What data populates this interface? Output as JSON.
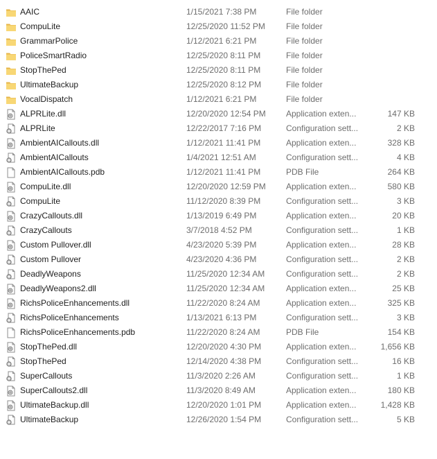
{
  "colors": {
    "folder": "#f8d775",
    "folder_dark": "#e6b54a",
    "secondary_text": "#6d6d6d",
    "primary_text": "#1e1e1e"
  },
  "files": [
    {
      "name": "AAIC",
      "date": "1/15/2021 7:38 PM",
      "type": "File folder",
      "size": "",
      "icon": "folder-icon"
    },
    {
      "name": "CompuLite",
      "date": "12/25/2020 11:52 PM",
      "type": "File folder",
      "size": "",
      "icon": "folder-icon"
    },
    {
      "name": "GrammarPolice",
      "date": "1/12/2021 6:21 PM",
      "type": "File folder",
      "size": "",
      "icon": "folder-icon"
    },
    {
      "name": "PoliceSmartRadio",
      "date": "12/25/2020 8:11 PM",
      "type": "File folder",
      "size": "",
      "icon": "folder-icon"
    },
    {
      "name": "StopThePed",
      "date": "12/25/2020 8:11 PM",
      "type": "File folder",
      "size": "",
      "icon": "folder-icon"
    },
    {
      "name": "UltimateBackup",
      "date": "12/25/2020 8:12 PM",
      "type": "File folder",
      "size": "",
      "icon": "folder-icon"
    },
    {
      "name": "VocalDispatch",
      "date": "1/12/2021 6:21 PM",
      "type": "File folder",
      "size": "",
      "icon": "folder-icon"
    },
    {
      "name": "ALPRLite.dll",
      "date": "12/20/2020 12:54 PM",
      "type": "Application exten...",
      "size": "147 KB",
      "icon": "dll-icon"
    },
    {
      "name": "ALPRLite",
      "date": "12/22/2017 7:16 PM",
      "type": "Configuration sett...",
      "size": "2 KB",
      "icon": "config-icon"
    },
    {
      "name": "AmbientAICallouts.dll",
      "date": "1/12/2021 11:41 PM",
      "type": "Application exten...",
      "size": "328 KB",
      "icon": "dll-icon"
    },
    {
      "name": "AmbientAICallouts",
      "date": "1/4/2021 12:51 AM",
      "type": "Configuration sett...",
      "size": "4 KB",
      "icon": "config-icon"
    },
    {
      "name": "AmbientAICallouts.pdb",
      "date": "1/12/2021 11:41 PM",
      "type": "PDB File",
      "size": "264 KB",
      "icon": "file-icon"
    },
    {
      "name": "CompuLite.dll",
      "date": "12/20/2020 12:59 PM",
      "type": "Application exten...",
      "size": "580 KB",
      "icon": "dll-icon"
    },
    {
      "name": "CompuLite",
      "date": "11/12/2020 8:39 PM",
      "type": "Configuration sett...",
      "size": "3 KB",
      "icon": "config-icon"
    },
    {
      "name": "CrazyCallouts.dll",
      "date": "1/13/2019 6:49 PM",
      "type": "Application exten...",
      "size": "20 KB",
      "icon": "dll-icon"
    },
    {
      "name": "CrazyCallouts",
      "date": "3/7/2018 4:52 PM",
      "type": "Configuration sett...",
      "size": "1 KB",
      "icon": "config-icon"
    },
    {
      "name": "Custom Pullover.dll",
      "date": "4/23/2020 5:39 PM",
      "type": "Application exten...",
      "size": "28 KB",
      "icon": "dll-icon"
    },
    {
      "name": "Custom Pullover",
      "date": "4/23/2020 4:36 PM",
      "type": "Configuration sett...",
      "size": "2 KB",
      "icon": "config-icon"
    },
    {
      "name": "DeadlyWeapons",
      "date": "11/25/2020 12:34 AM",
      "type": "Configuration sett...",
      "size": "2 KB",
      "icon": "config-icon"
    },
    {
      "name": "DeadlyWeapons2.dll",
      "date": "11/25/2020 12:34 AM",
      "type": "Application exten...",
      "size": "25 KB",
      "icon": "dll-icon"
    },
    {
      "name": "RichsPoliceEnhancements.dll",
      "date": "11/22/2020 8:24 AM",
      "type": "Application exten...",
      "size": "325 KB",
      "icon": "dll-icon"
    },
    {
      "name": "RichsPoliceEnhancements",
      "date": "1/13/2021 6:13 PM",
      "type": "Configuration sett...",
      "size": "3 KB",
      "icon": "config-icon"
    },
    {
      "name": "RichsPoliceEnhancements.pdb",
      "date": "11/22/2020 8:24 AM",
      "type": "PDB File",
      "size": "154 KB",
      "icon": "file-icon"
    },
    {
      "name": "StopThePed.dll",
      "date": "12/20/2020 4:30 PM",
      "type": "Application exten...",
      "size": "1,656 KB",
      "icon": "dll-icon"
    },
    {
      "name": "StopThePed",
      "date": "12/14/2020 4:38 PM",
      "type": "Configuration sett...",
      "size": "16 KB",
      "icon": "config-icon"
    },
    {
      "name": "SuperCallouts",
      "date": "11/3/2020 2:26 AM",
      "type": "Configuration sett...",
      "size": "1 KB",
      "icon": "config-icon"
    },
    {
      "name": "SuperCallouts2.dll",
      "date": "11/3/2020 8:49 AM",
      "type": "Application exten...",
      "size": "180 KB",
      "icon": "dll-icon"
    },
    {
      "name": "UltimateBackup.dll",
      "date": "12/20/2020 1:01 PM",
      "type": "Application exten...",
      "size": "1,428 KB",
      "icon": "dll-icon"
    },
    {
      "name": "UltimateBackup",
      "date": "12/26/2020 1:54 PM",
      "type": "Configuration sett...",
      "size": "5 KB",
      "icon": "config-icon"
    }
  ]
}
